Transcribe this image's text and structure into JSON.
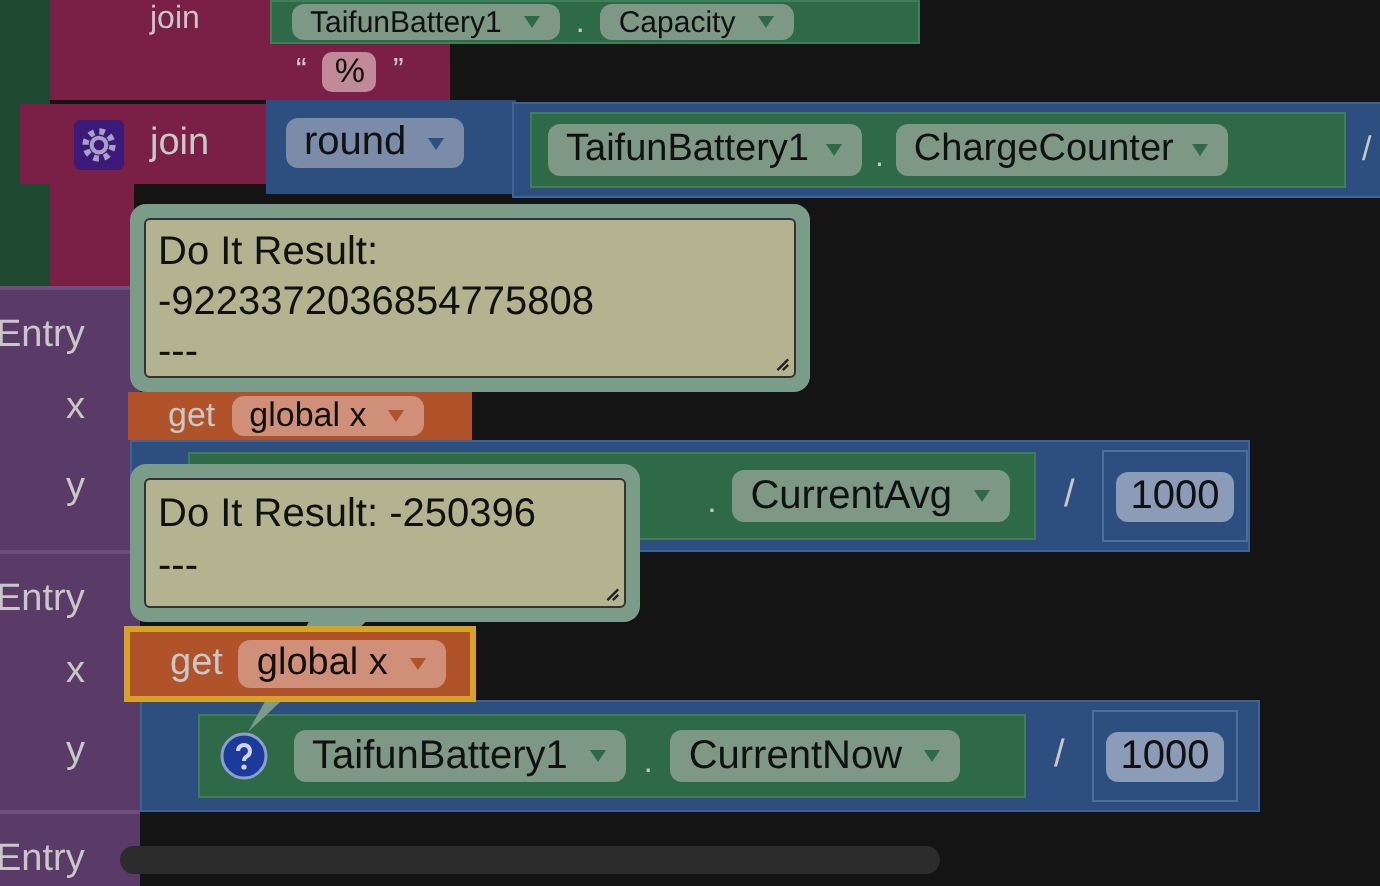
{
  "top_join": {
    "label": "join",
    "component": "TaifunBattery1",
    "separator": ".",
    "property": "Capacity"
  },
  "text_block": {
    "open_quote": "“",
    "value": "%",
    "close_quote": "”"
  },
  "join_block": {
    "label": "join",
    "math": "round",
    "component": "TaifunBattery1",
    "separator": ".",
    "property": "ChargeCounter",
    "operator": "/"
  },
  "entries": [
    {
      "label": "Entry",
      "x_label": "x",
      "get": "get",
      "variable": "global x",
      "y_label": "y",
      "separator": ".",
      "property": "CurrentAvg",
      "operator": "/",
      "divisor": "1000"
    },
    {
      "label": "Entry",
      "x_label": "x",
      "get": "get",
      "variable": "global x",
      "y_label": "y",
      "component": "TaifunBattery1",
      "separator": ".",
      "property": "CurrentNow",
      "operator": "/",
      "divisor": "1000"
    },
    {
      "label": "Entry"
    }
  ],
  "results": [
    {
      "lines": [
        "Do It Result:",
        "-9223372036854775808",
        "---"
      ]
    },
    {
      "lines": [
        "Do It Result: -250396",
        "---"
      ]
    }
  ]
}
